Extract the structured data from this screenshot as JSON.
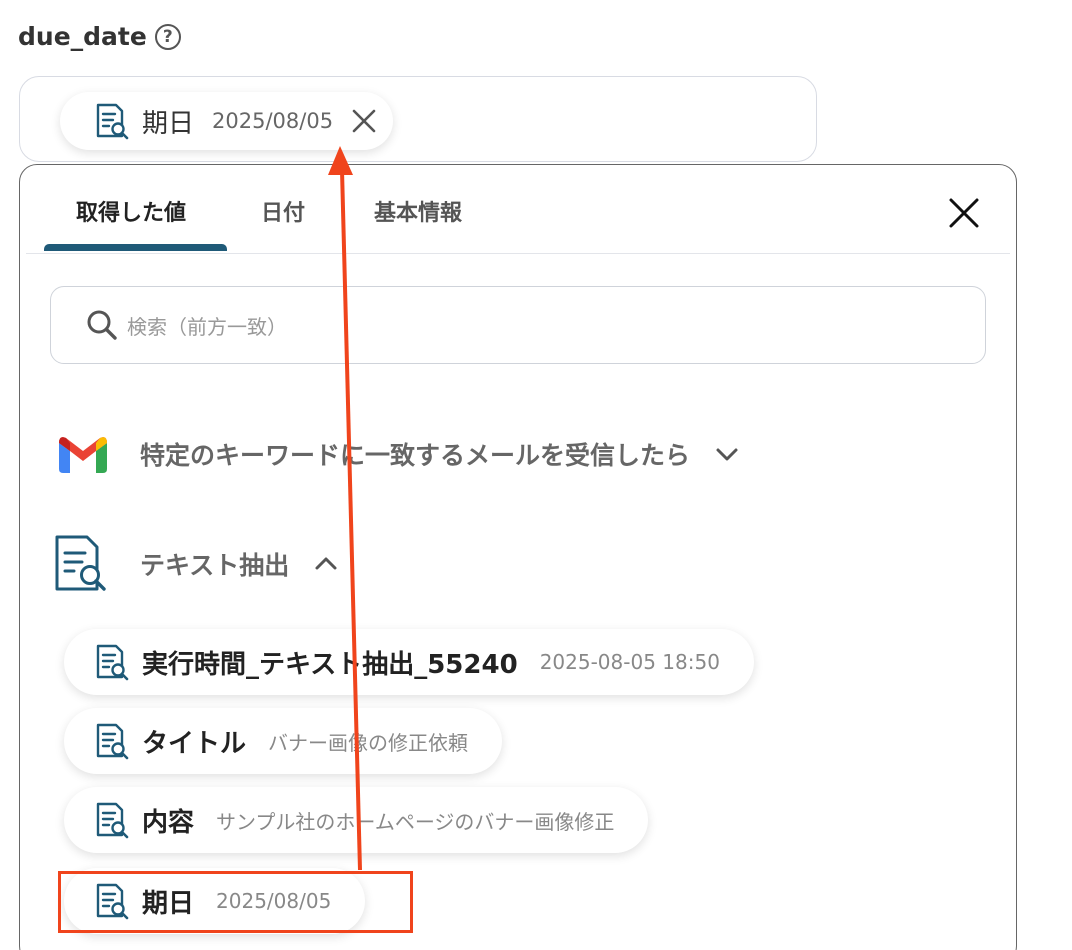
{
  "field": {
    "label": "due_date",
    "help_icon": "?",
    "selected_chip": {
      "key": "期日",
      "value": "2025/08/05"
    }
  },
  "tabs": [
    {
      "label": "取得した値",
      "active": true
    },
    {
      "label": "日付",
      "active": false
    },
    {
      "label": "基本情報",
      "active": false
    }
  ],
  "search": {
    "placeholder": "検索（前方一致）"
  },
  "sections": {
    "gmail": {
      "title": "特定のキーワードに一致するメールを受信したら",
      "expanded": false
    },
    "text_extraction": {
      "title": "テキスト抽出",
      "expanded": true,
      "items": [
        {
          "key": "実行時間_テキスト抽出_55240",
          "value": "2025-08-05 18:50"
        },
        {
          "key": "タイトル",
          "value": "バナー画像の修正依頼"
        },
        {
          "key": "内容",
          "value": "サンプル社のホームページのバナー画像修正"
        },
        {
          "key": "期日",
          "value": "2025/08/05"
        }
      ]
    }
  },
  "colors": {
    "accent": "#1f5a78",
    "highlight": "#f0441c",
    "gmail_red": "#ea4335",
    "gmail_blue": "#4285f4",
    "gmail_green": "#34a853",
    "gmail_yellow": "#fbbc04"
  },
  "icons": [
    "help-icon",
    "document-search-icon",
    "close-icon",
    "search-icon",
    "gmail-icon",
    "chevron-down-icon",
    "chevron-up-icon"
  ]
}
